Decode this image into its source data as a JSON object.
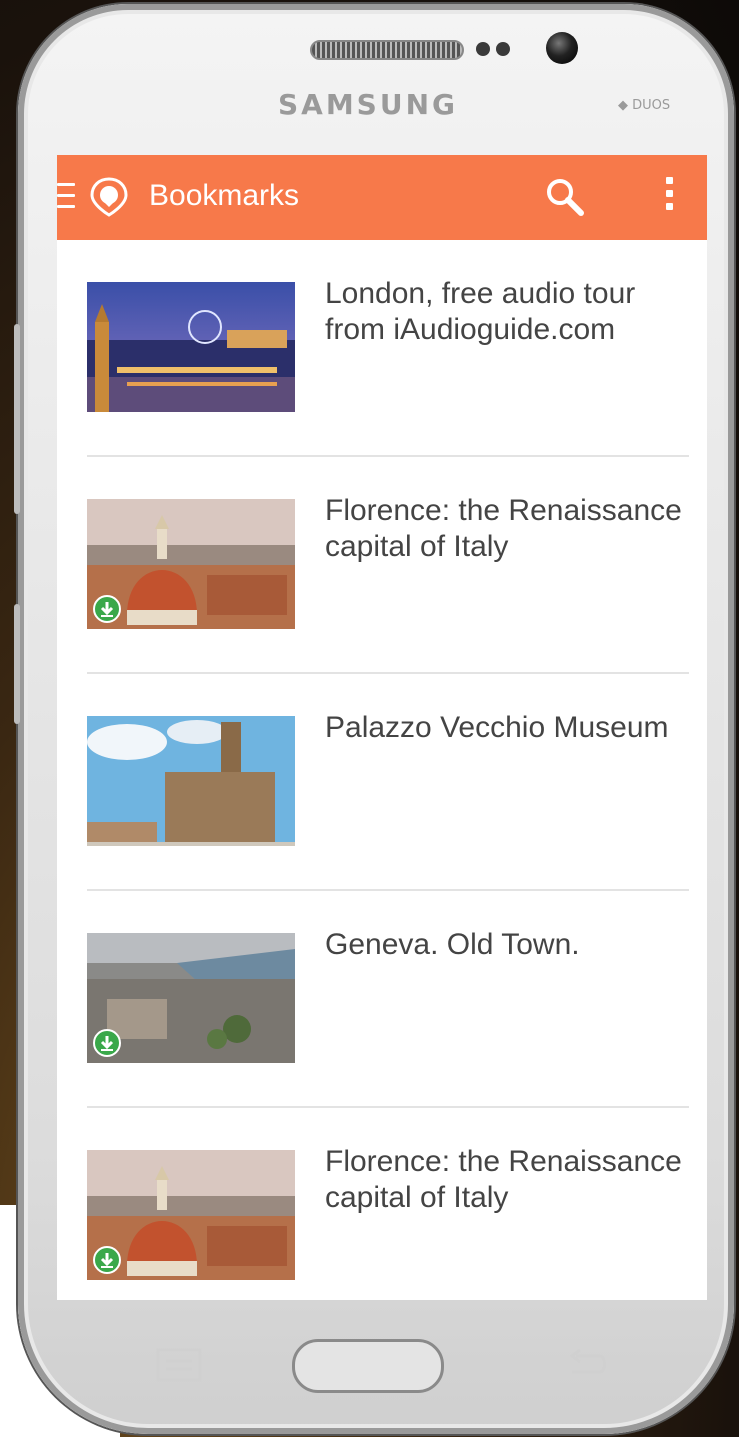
{
  "device": {
    "brand": "SAMSUNG",
    "model_badge": "DUOS"
  },
  "appbar": {
    "title": "Bookmarks",
    "menu_icon": "hamburger-icon",
    "logo_icon": "location-pin-icon",
    "search_icon": "search-icon",
    "overflow_icon": "more-vert-icon",
    "color": "#f7794a"
  },
  "bookmarks": [
    {
      "title": "London, free audio tour from iAudioguide.com",
      "downloaded": false,
      "thumb": "london-night"
    },
    {
      "title": "Florence: the Renaissance capital of Italy",
      "downloaded": true,
      "thumb": "florence-dome"
    },
    {
      "title": "Palazzo Vecchio Museum",
      "downloaded": false,
      "thumb": "palazzo-vecchio"
    },
    {
      "title": "Geneva. Old Town.",
      "downloaded": true,
      "thumb": "geneva-aerial"
    },
    {
      "title": "Florence: the Renaissance capital of Italy",
      "downloaded": true,
      "thumb": "florence-dome"
    }
  ],
  "colors": {
    "download_badge": "#3aa84a",
    "text": "#444444"
  }
}
